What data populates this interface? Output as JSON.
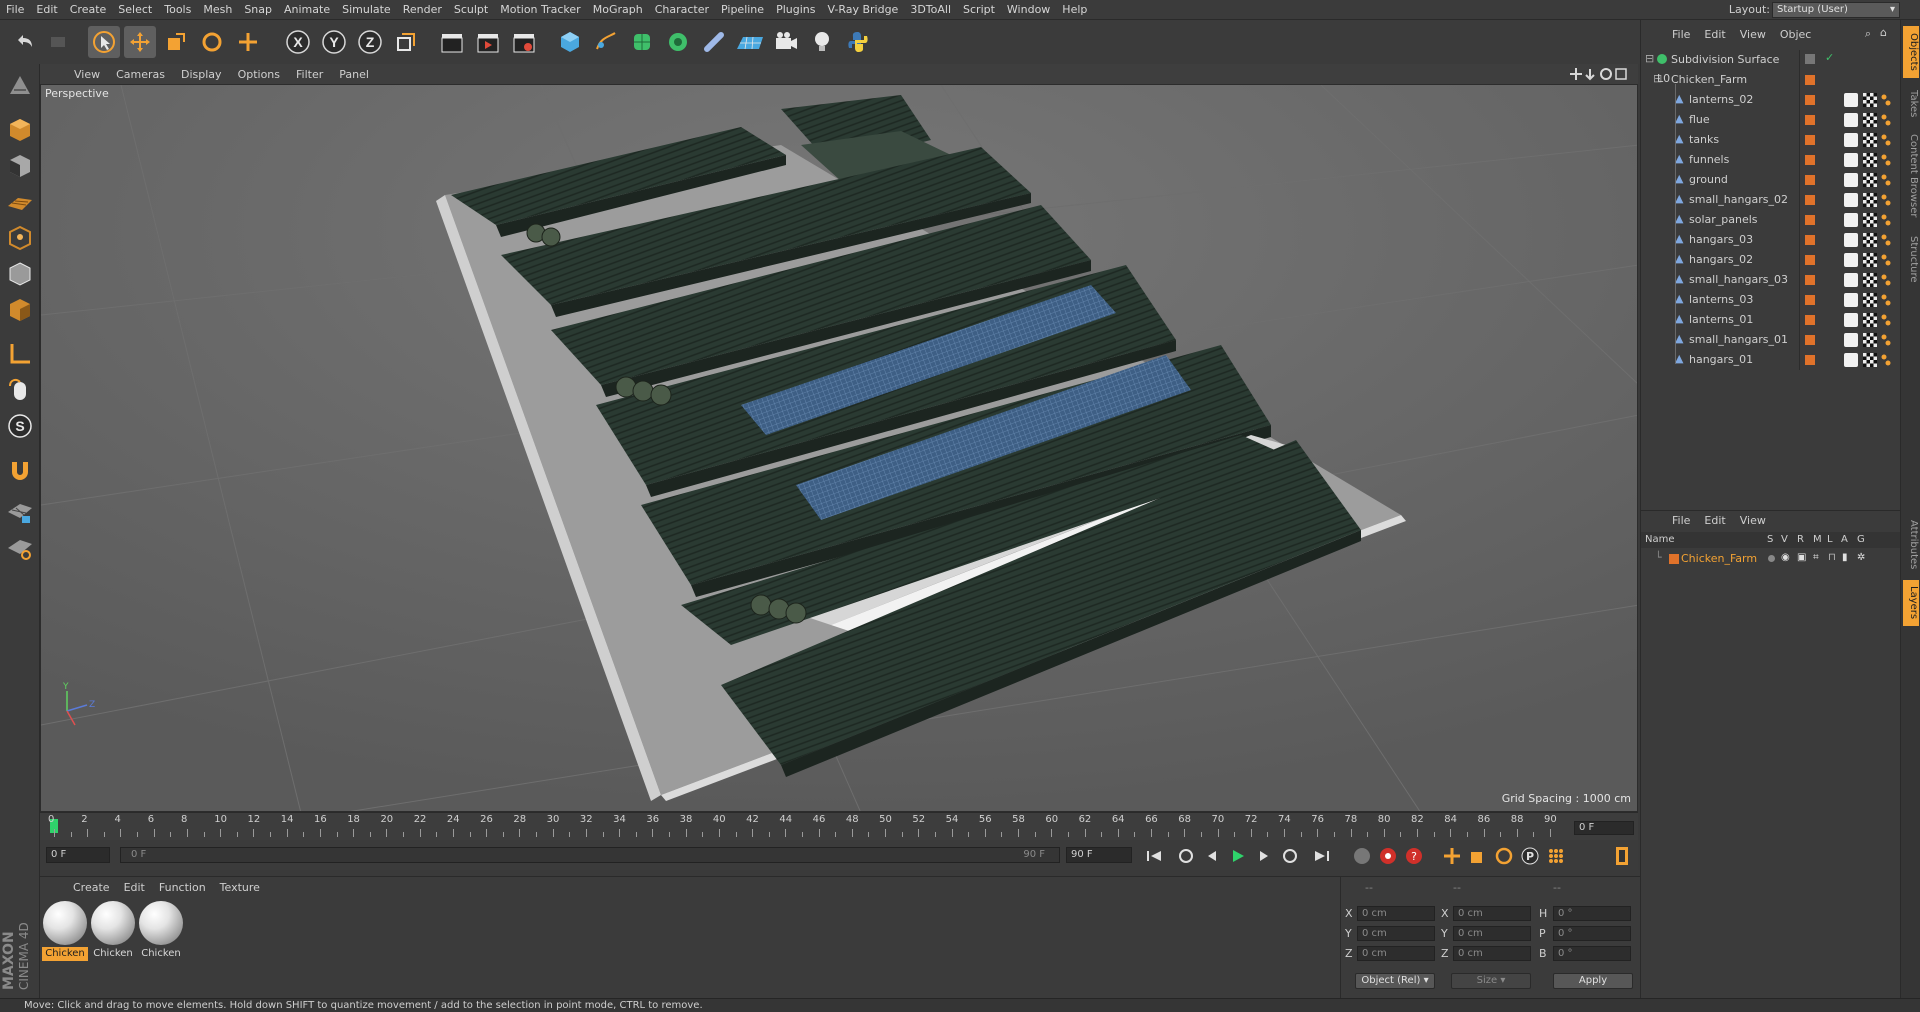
{
  "menu": [
    "File",
    "Edit",
    "Create",
    "Select",
    "Tools",
    "Mesh",
    "Snap",
    "Animate",
    "Simulate",
    "Render",
    "Sculpt",
    "Motion Tracker",
    "MoGraph",
    "Character",
    "Pipeline",
    "Plugins",
    "V-Ray Bridge",
    "3DToAll",
    "Script",
    "Window",
    "Help"
  ],
  "layout": {
    "label": "Layout:",
    "value": "Startup (User)"
  },
  "viewport": {
    "menu": [
      "View",
      "Cameras",
      "Display",
      "Options",
      "Filter",
      "Panel"
    ],
    "label": "Perspective",
    "grid_spacing": "Grid Spacing : 1000 cm"
  },
  "timeline": {
    "ticks": [
      "0",
      "2",
      "4",
      "6",
      "8",
      "10",
      "12",
      "14",
      "16",
      "18",
      "20",
      "22",
      "24",
      "26",
      "28",
      "30",
      "32",
      "34",
      "36",
      "38",
      "40",
      "42",
      "44",
      "46",
      "48",
      "50",
      "52",
      "54",
      "56",
      "58",
      "60",
      "62",
      "64",
      "66",
      "68",
      "70",
      "72",
      "74",
      "76",
      "78",
      "80",
      "82",
      "84",
      "86",
      "88",
      "90"
    ],
    "end_field": "0 F"
  },
  "transport": {
    "current_frame": "0 F",
    "range_start": "0 F",
    "range_end": "90 F",
    "max_frame": "90 F"
  },
  "materials": {
    "menu": [
      "Create",
      "Edit",
      "Function",
      "Texture"
    ],
    "items": [
      {
        "label": "Chicken",
        "active": true
      },
      {
        "label": "Chicken",
        "active": false
      },
      {
        "label": "Chicken",
        "active": false
      }
    ]
  },
  "coordinates": {
    "header": [
      "--",
      "--",
      "--"
    ],
    "rows": [
      {
        "a": "X",
        "a_val": "0 cm",
        "b": "X",
        "b_val": "0 cm",
        "c": "H",
        "c_val": "0 °"
      },
      {
        "a": "Y",
        "a_val": "0 cm",
        "b": "Y",
        "b_val": "0 cm",
        "c": "P",
        "c_val": "0 °"
      },
      {
        "a": "Z",
        "a_val": "0 cm",
        "b": "Z",
        "b_val": "0 cm",
        "c": "B",
        "c_val": "0 °"
      }
    ],
    "mode": "Object (Rel)",
    "size": "Size",
    "apply": "Apply"
  },
  "status": "Move: Click and drag to move elements. Hold down SHIFT to quantize movement / add to the selection in point mode, CTRL to remove.",
  "object_manager": {
    "menu": [
      "File",
      "Edit",
      "View",
      "Objec"
    ],
    "root": "Subdivision Surface",
    "group": "Chicken_Farm",
    "children": [
      "lanterns_02",
      "flue",
      "tanks",
      "funnels",
      "ground",
      "small_hangars_02",
      "solar_panels",
      "hangars_03",
      "hangars_02",
      "small_hangars_03",
      "lanterns_03",
      "lanterns_01",
      "small_hangars_01",
      "hangars_01"
    ]
  },
  "layer_manager": {
    "menu": [
      "File",
      "Edit",
      "View"
    ],
    "columns": [
      "Name",
      "S",
      "V",
      "R",
      "M",
      "L",
      "A",
      "G"
    ],
    "layer": "Chicken_Farm"
  },
  "side_tabs": [
    "Objects",
    "Takes",
    "Content Browser",
    "Structure",
    "Attributes",
    "Layers"
  ],
  "maxon": [
    "MAXON",
    "CINEMA 4D"
  ]
}
